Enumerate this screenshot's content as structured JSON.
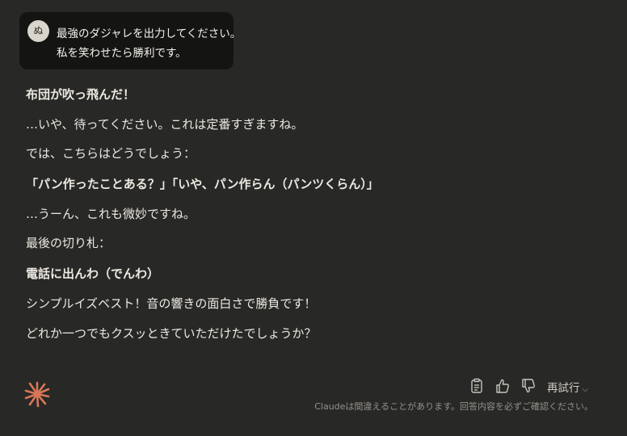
{
  "user_message": {
    "avatar_initial": "ぬ",
    "lines": [
      "最強のダジャレを出力してください。",
      "私を笑わせたら勝利です。"
    ]
  },
  "response": {
    "paragraphs": [
      "布団が吹っ飛んだ！",
      "…いや、待ってください。これは定番すぎますね。",
      "では、こちらはどうでしょう：",
      "「パン作ったことある？」「いや、パン作らん（パンツくらん）」",
      "…うーん、これも微妙ですね。",
      "最後の切り札：",
      "電話に出んわ（でんわ）",
      "シンプルイズベスト！音の響きの面白さで勝負です！",
      "どれか一つでもクスッときていただけたでしょうか？"
    ]
  },
  "actions": {
    "copy_icon": "clipboard-icon",
    "like_icon": "thumbs-up-icon",
    "dislike_icon": "thumbs-down-icon",
    "retry_label": "再試行"
  },
  "disclaimer": "Claudeは間違えることがあります。回答内容を必ずご確認ください。",
  "colors": {
    "background": "#282826",
    "user_bubble": "#141413",
    "claude_accent": "#d97757"
  }
}
